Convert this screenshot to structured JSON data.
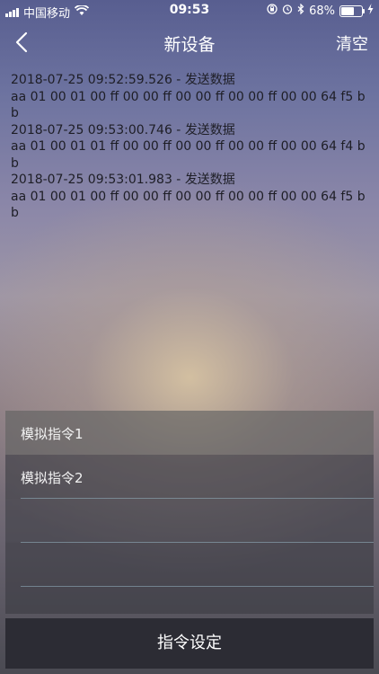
{
  "status_bar": {
    "carrier": "中国移动",
    "time": "09:53",
    "battery": "68%",
    "battery_level": 0.68,
    "icons": [
      "signal-icon",
      "wifi-icon",
      "orientation-lock-icon",
      "alarm-icon",
      "bluetooth-icon",
      "battery-icon",
      "charging-icon"
    ]
  },
  "nav": {
    "title": "新设备",
    "clear_label": "清空",
    "back_icon": "chevron-left-icon"
  },
  "log": [
    {
      "head": "2018-07-25 09:52:59.526 - 发送数据",
      "data": "aa 01 00 01 00 ff 00 00 ff 00 00 ff 00 00 ff 00 00 64 f5 bb"
    },
    {
      "head": "2018-07-25 09:53:00.746 - 发送数据",
      "data": "aa 01 00 01 01 ff 00 00 ff 00 00 ff 00 00 ff 00 00 64 f4 bb"
    },
    {
      "head": "2018-07-25 09:53:01.983 - 发送数据",
      "data": "aa 01 00 01 00 ff 00 00 ff 00 00 ff 00 00 ff 00 00 64 f5 bb"
    }
  ],
  "commands": [
    "模拟指令1",
    "模拟指令2",
    "",
    "",
    ""
  ],
  "footer_button": "指令设定"
}
